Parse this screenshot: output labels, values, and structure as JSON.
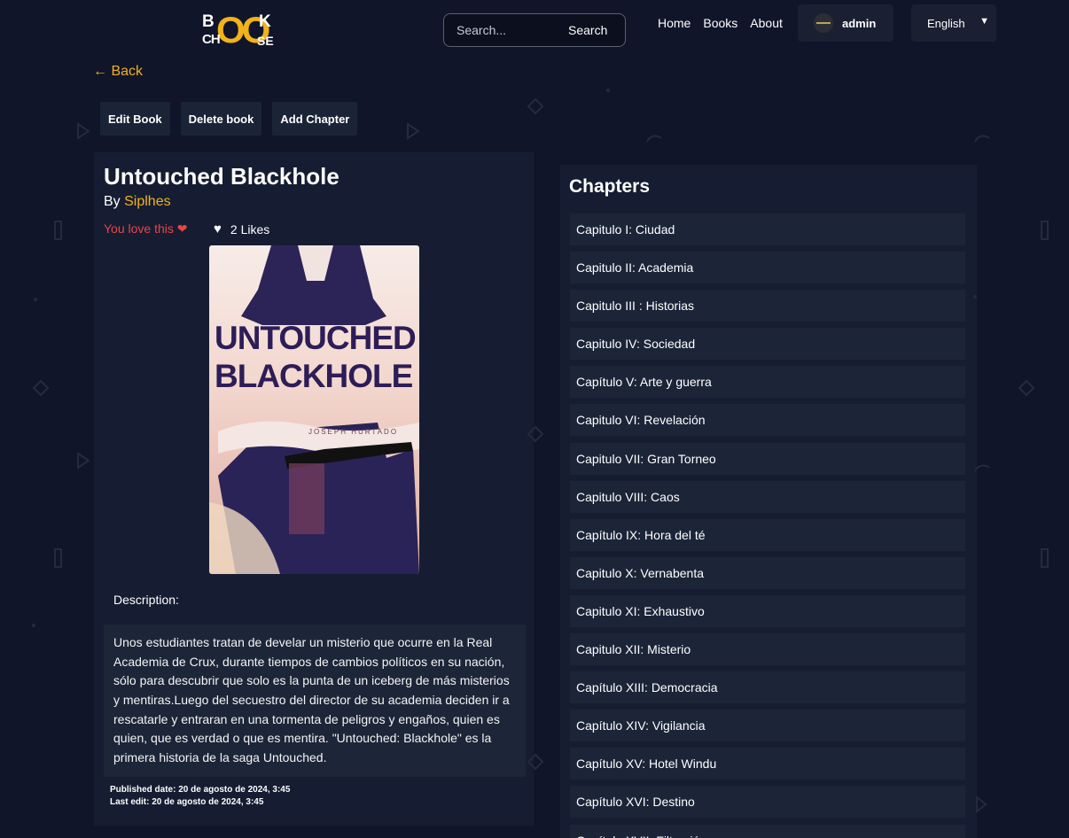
{
  "nav": {
    "logo": {
      "top": "B",
      "top2": "K",
      "oo": "OO",
      "bottom": "CH",
      "bottom2": "SE"
    },
    "search_placeholder": "Search...",
    "search_button": "Search",
    "links": [
      "Home",
      "Books",
      "About"
    ],
    "user": "admin",
    "language": "English"
  },
  "back_label": "← Back",
  "actions": [
    "Edit Book",
    "Delete book",
    "Add Chapter"
  ],
  "book": {
    "title": "Untouched Blackhole",
    "by_prefix": "By",
    "author": "Siplhes",
    "love_text": "You love this",
    "likes": "2 Likes",
    "cover_title_1": "UNTOUCHED",
    "cover_title_2": "BLACKHOLE",
    "cover_author": "JOSEPH HURTADO",
    "description_label": "Description:",
    "description": "Unos estudiantes tratan de develar un misterio que ocurre en la Real Academia de Crux, durante tiempos de cambios políticos en su nación, sólo para descubrir que solo es la punta de un iceberg de más misterios y mentiras.Luego del secuestro del director de su academia deciden ir a rescatarle y entraran en una tormenta de peligros y engaños, quien es quien, que es verdad o que es mentira. \"Untouched: Blackhole\" es la primera historia de la saga Untouched.",
    "published": "Published date: 20 de agosto de 2024, 3:45",
    "last_edit": "Last edit: 20 de agosto de 2024, 3:45"
  },
  "chapters_title": "Chapters",
  "chapters": [
    "Capitulo I: Ciudad",
    "Capitulo II: Academia",
    "Capitulo III : Historias",
    "Capitulo IV: Sociedad",
    "Capítulo V: Arte y guerra",
    "Capitulo VI: Revelación",
    "Capitulo VII: Gran Torneo",
    "Capitulo VIII: Caos",
    "Capítulo IX: Hora del té",
    "Capitulo X: Vernabenta",
    "Capitulo XI: Exhaustivo",
    "Capitulo XII: Misterio",
    "Capítulo XIII: Democracia",
    "Capítulo XIV: Vigilancia",
    "Capítulo XV: Hotel Windu",
    "Capítulo XVI: Destino",
    "Capítulo XVII: Filtración"
  ],
  "colors": {
    "accent": "#f2b21a",
    "love": "#e84545",
    "background": "#10152a"
  }
}
